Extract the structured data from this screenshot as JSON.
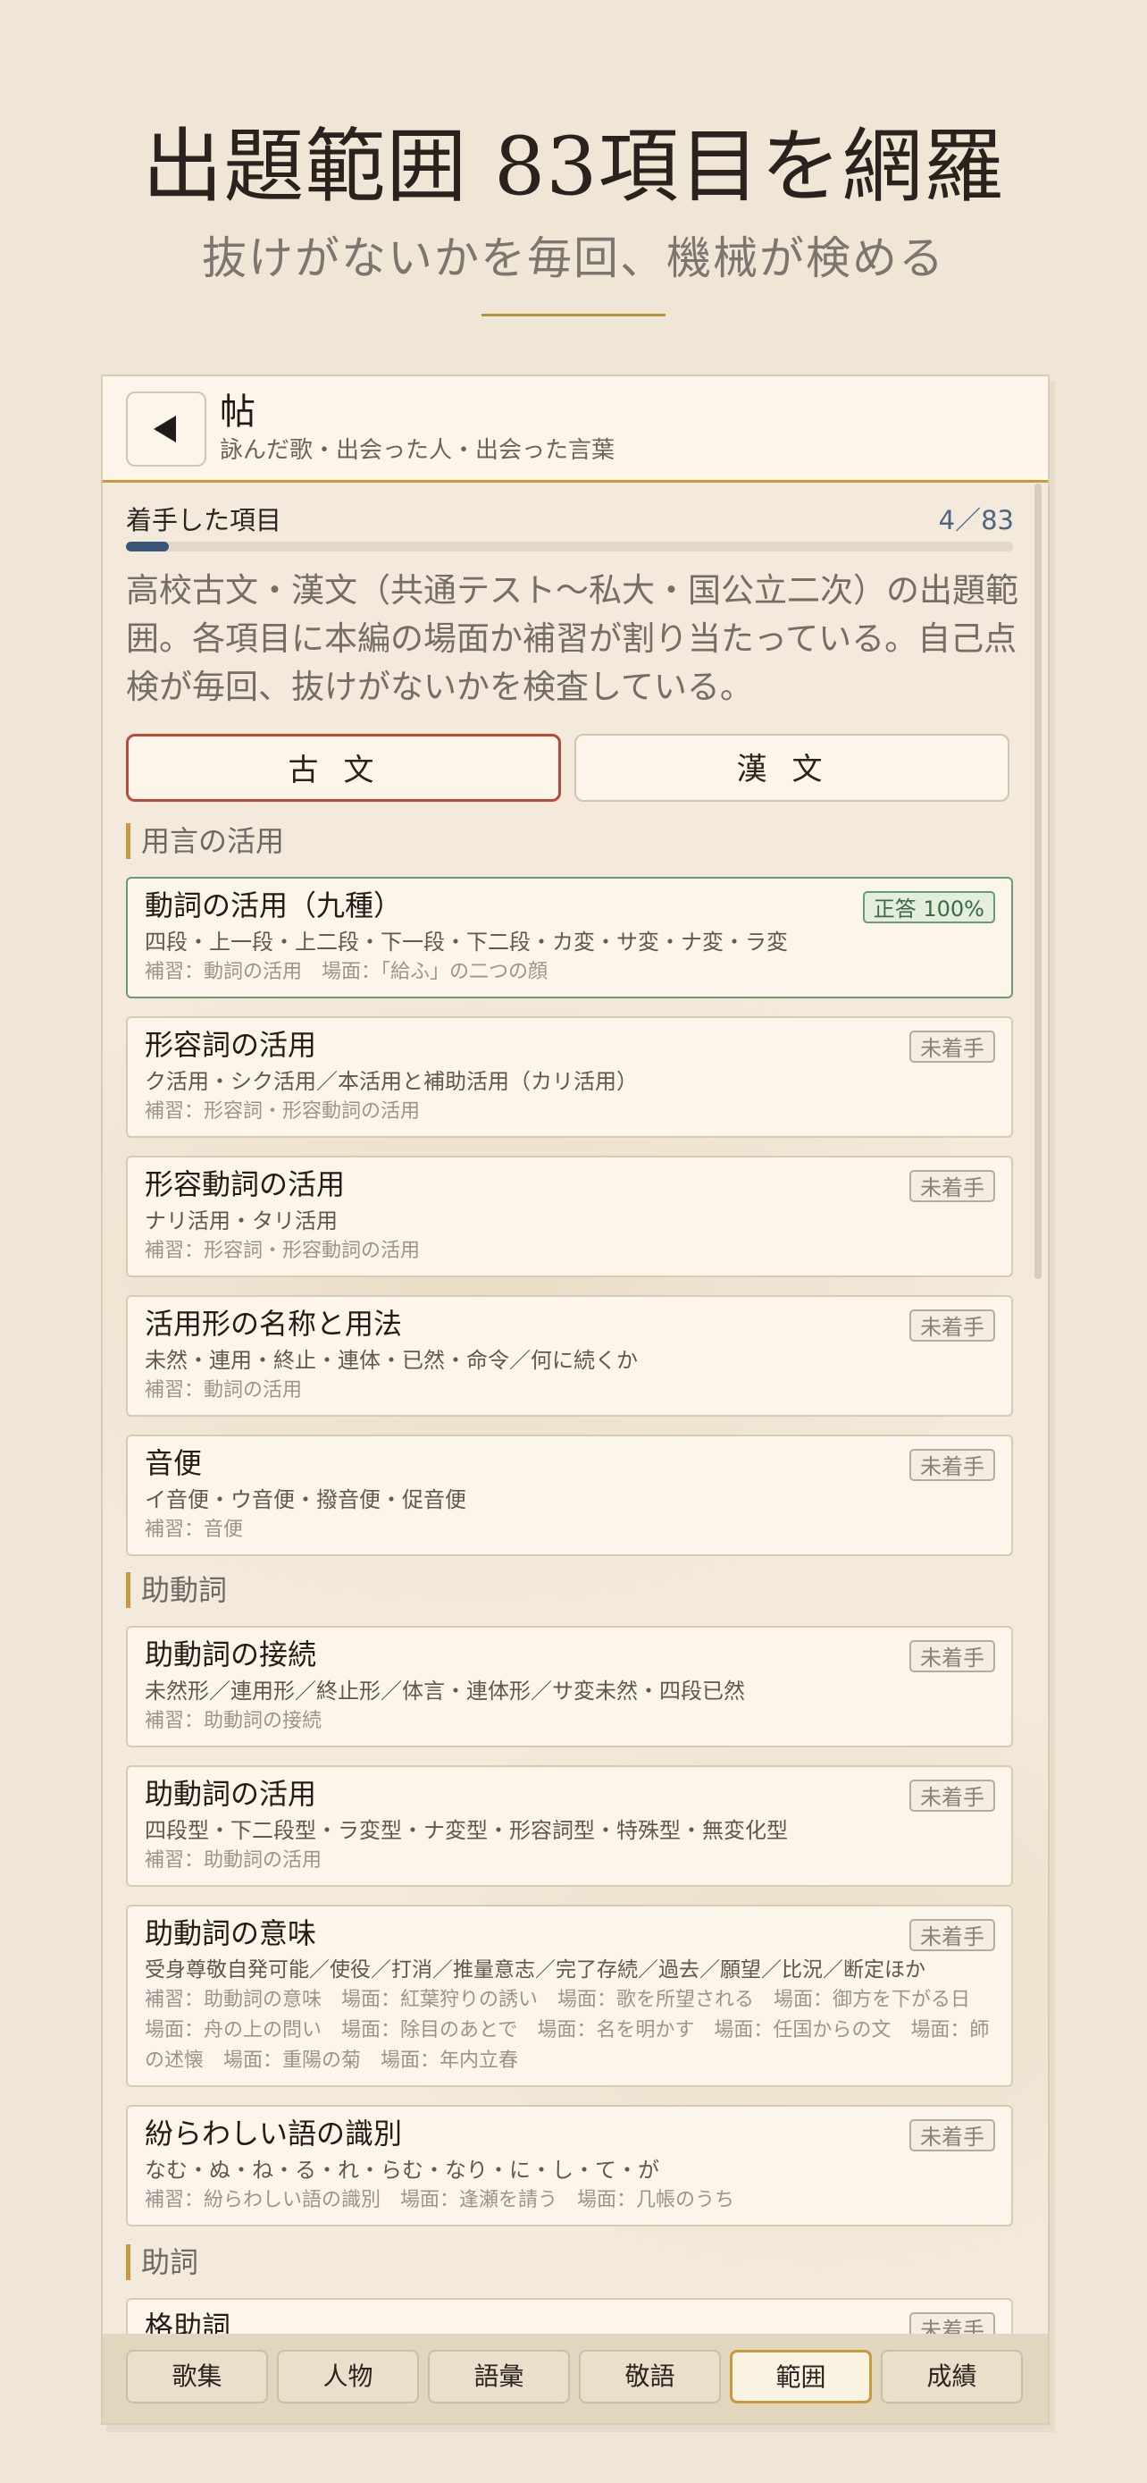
{
  "hero": {
    "title": "出題範囲 83項目を網羅",
    "subtitle": "抜けがないかを毎回、機械が検める"
  },
  "header": {
    "back_icon": "back-triangle-icon",
    "title": "帖",
    "subtitle": "詠んだ歌・出会った人・出会った言葉"
  },
  "progress": {
    "label": "着手した項目",
    "count_text": "4／83",
    "done": 4,
    "total": 83
  },
  "intro": "高校古文・漢文（共通テスト〜私大・国公立二次）の出題範囲。各項目に本編の場面か補習が割り当たっている。自己点検が毎回、抜けがないかを検査している。",
  "tabs": [
    {
      "label": "古文",
      "active": true
    },
    {
      "label": "漢文",
      "active": false
    }
  ],
  "sections": [
    {
      "title": "用言の活用"
    },
    {
      "title": "助動詞"
    },
    {
      "title": "助詞"
    }
  ],
  "items": [
    {
      "title": "動詞の活用（九種）",
      "desc": "四段・上一段・上二段・下一段・下二段・カ変・サ変・ナ変・ラ変",
      "note": "補習：動詞の活用　場面：「給ふ」の二つの顔",
      "badge": "正答 100%",
      "status": "done"
    },
    {
      "title": "形容詞の活用",
      "desc": "ク活用・シク活用／本活用と補助活用（カリ活用）",
      "note": "補習：形容詞・形容動詞の活用",
      "badge": "未着手",
      "status": "todo"
    },
    {
      "title": "形容動詞の活用",
      "desc": "ナリ活用・タリ活用",
      "note": "補習：形容詞・形容動詞の活用",
      "badge": "未着手",
      "status": "todo"
    },
    {
      "title": "活用形の名称と用法",
      "desc": "未然・連用・終止・連体・已然・命令／何に続くか",
      "note": "補習：動詞の活用",
      "badge": "未着手",
      "status": "todo"
    },
    {
      "title": "音便",
      "desc": "イ音便・ウ音便・撥音便・促音便",
      "note": "補習：音便",
      "badge": "未着手",
      "status": "todo"
    },
    {
      "title": "助動詞の接続",
      "desc": "未然形／連用形／終止形／体言・連体形／サ変未然・四段已然",
      "note": "補習：助動詞の接続",
      "badge": "未着手",
      "status": "todo"
    },
    {
      "title": "助動詞の活用",
      "desc": "四段型・下二段型・ラ変型・ナ変型・形容詞型・特殊型・無変化型",
      "note": "補習：助動詞の活用",
      "badge": "未着手",
      "status": "todo"
    },
    {
      "title": "助動詞の意味",
      "desc": "受身尊敬自発可能／使役／打消／推量意志／完了存続／過去／願望／比況／断定ほか",
      "note": "補習：助動詞の意味　場面：紅葉狩りの誘い　場面：歌を所望される　場面：御方を下がる日　場面：舟の上の問い　場面：除目のあとで　場面：名を明かす　場面：任国からの文　場面：師の述懐　場面：重陽の菊　場面：年内立春",
      "badge": "未着手",
      "status": "todo"
    },
    {
      "title": "紛らわしい語の識別",
      "desc": "なむ・ぬ・ね・る・れ・らむ・なり・に・し・て・が",
      "note": "補習：紛らわしい語の識別　場面：逢瀬を請う　場面：几帳のうち",
      "badge": "未着手",
      "status": "todo"
    },
    {
      "title": "格助詞",
      "badge": "未着手",
      "status": "todo"
    }
  ],
  "bottom_nav": [
    {
      "label": "歌集",
      "active": false
    },
    {
      "label": "人物",
      "active": false
    },
    {
      "label": "語彙",
      "active": false
    },
    {
      "label": "敬語",
      "active": false
    },
    {
      "label": "範囲",
      "active": true
    },
    {
      "label": "成績",
      "active": false
    }
  ],
  "colors": {
    "background": "#efe6d6",
    "accent_gold": "#c79a3a",
    "active_tab_border": "#b84a3c",
    "progress_fill": "#3c5475",
    "done_green": "#6c9a72"
  }
}
